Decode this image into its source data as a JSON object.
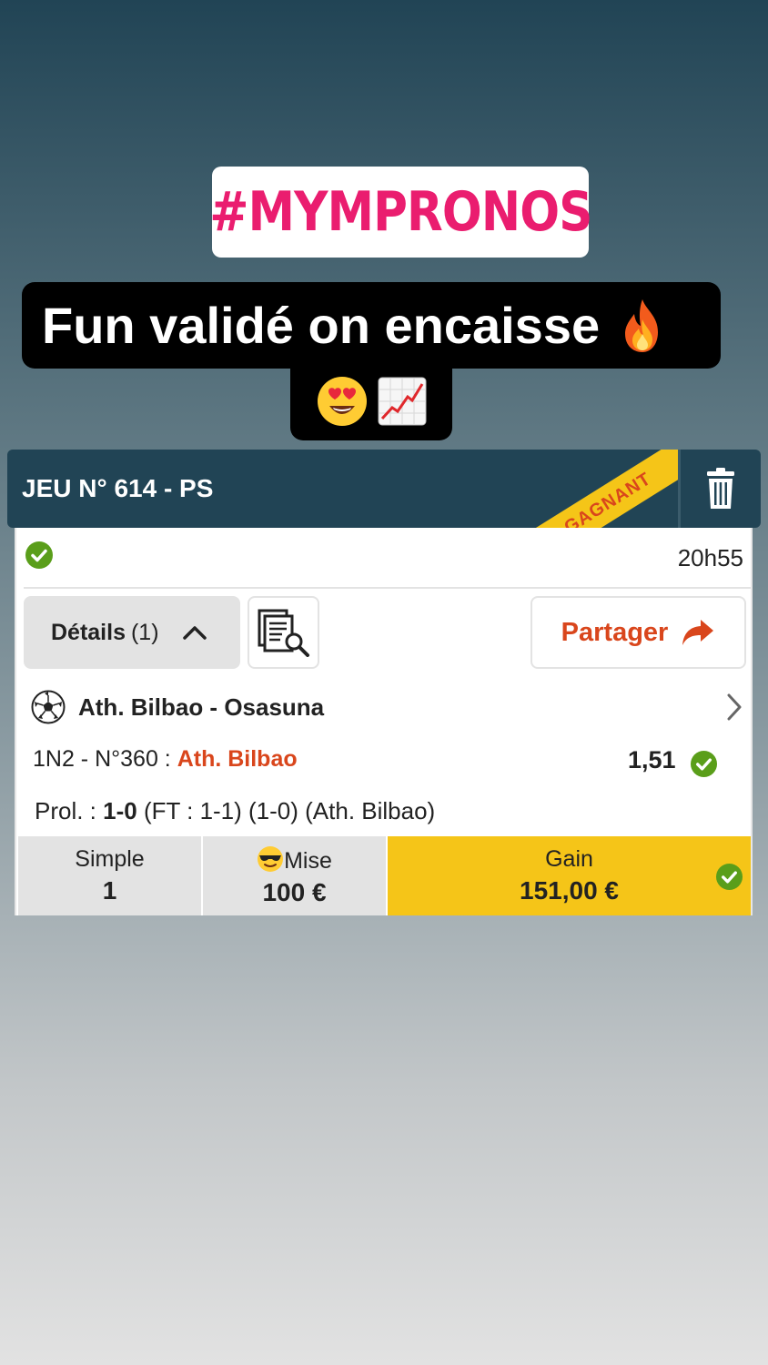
{
  "story": {
    "hashtag": "#MYMPRONOS",
    "caption_line1": "Fun validé on encaisse",
    "caption_emojis": [
      "fire-emoji",
      "heart-eyes-emoji",
      "chart-increasing-emoji"
    ]
  },
  "bet": {
    "title": "JEU N° 614 - PS",
    "status_ribbon": "GAGNANT",
    "time": "20h55",
    "details_label": "Détails",
    "details_count": "(1)",
    "share_label": "Partager",
    "match": "Ath. Bilbao - Osasuna",
    "bet_type": "1N2 - N°360 : ",
    "selection": "Ath. Bilbao",
    "odds": "1,51",
    "result_prefix": "Prol. : ",
    "result_score": "1-0",
    "result_suffix": " (FT : 1-1) (1-0) (Ath. Bilbao)",
    "footer": {
      "type_label": "Simple",
      "type_value": "1",
      "stake_label": "Mise",
      "stake_value": "100 €",
      "gain_label": "Gain",
      "gain_value": "151,00 €"
    }
  },
  "colors": {
    "header": "#214455",
    "accent_orange": "#d9461c",
    "gain_yellow": "#f5c518",
    "success_green": "#5a9e1a",
    "hashtag_pink": "#ea1d6f"
  }
}
